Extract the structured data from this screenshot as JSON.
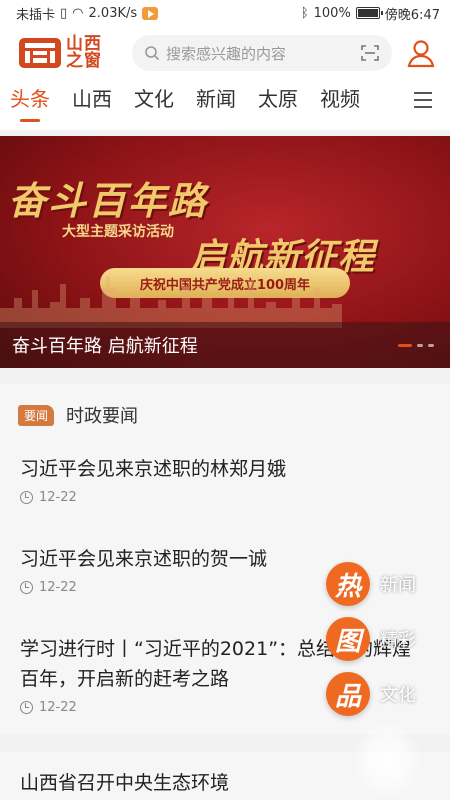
{
  "status_bar": {
    "left_text": "未插卡",
    "speed": "2.03K/s",
    "battery": "100%",
    "time": "傍晚6:47"
  },
  "header": {
    "logo_line1": "山西",
    "logo_line2": "之窗",
    "search_placeholder": "搜索感兴趣的内容",
    "icons": [
      "search-icon",
      "scan-icon",
      "user-icon"
    ],
    "brand_color": "#d2491f"
  },
  "tabs": [
    {
      "label": "头条",
      "active": true
    },
    {
      "label": "山西",
      "active": false
    },
    {
      "label": "文化",
      "active": false
    },
    {
      "label": "新闻",
      "active": false
    },
    {
      "label": "太原",
      "active": false
    },
    {
      "label": "视频",
      "active": false
    }
  ],
  "banner": {
    "headline": "奋斗百年路",
    "subheadline": "启航新征程",
    "activity": "大型主题采访活动",
    "pill": "庆祝中国共产党成立100周年",
    "caption": "奋斗百年路 启航新征程"
  },
  "section": {
    "tag": "要闻",
    "title": "时政要闻"
  },
  "news": [
    {
      "title": "习近平会见来京述职的林郑月娥",
      "date": "12-22"
    },
    {
      "title": "习近平会见来京述职的贺一诚",
      "date": "12-22"
    },
    {
      "title": "学习进行时丨“习近平的2021”：总结党的辉煌百年，开启新的赶考之路",
      "date": "12-22"
    }
  ],
  "next_news": {
    "title": "山西省召开中央生态环境"
  },
  "floating_menu": [
    {
      "glyph": "热",
      "label": "新闻"
    },
    {
      "glyph": "图",
      "label": "精彩"
    },
    {
      "glyph": "品",
      "label": "文化"
    }
  ],
  "accent_color": "#e0501a"
}
